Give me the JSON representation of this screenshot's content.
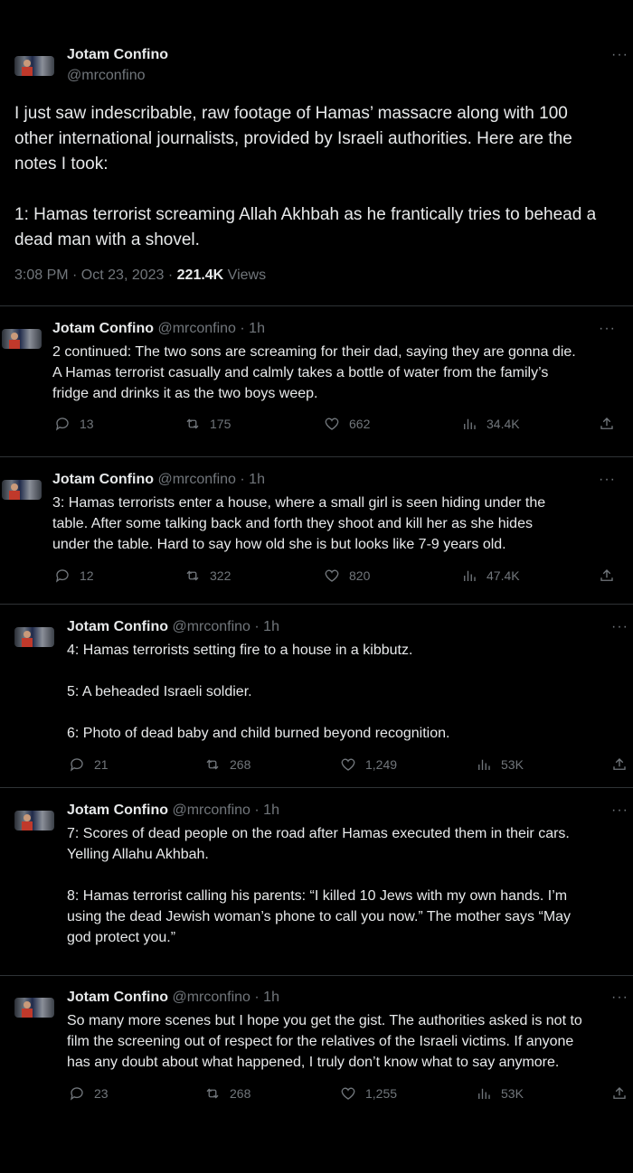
{
  "main_tweet": {
    "name": "Jotam Confino",
    "handle": "@mrconfino",
    "more": "···",
    "p1_l1": "I just saw indescribable, raw footage of Hamas’ massacre along with 100",
    "p1_l2": "other international journalists, provided by Israeli authorities. Here are the",
    "p1_l3": "notes I took:",
    "p2_l1": "1: Hamas terrorist screaming Allah Akhbah as he frantically tries to behead a",
    "p2_l2": "dead man with a shovel.",
    "timestamp": "3:08 PM · Oct 23, 2023 · ",
    "views_count": "221.4K",
    "views_label": " Views"
  },
  "replies": [
    {
      "name": "Jotam Confino",
      "handle": "@mrconfino · 1h",
      "more": "···",
      "lines": [
        "2 continued: The two sons are screaming for their dad, saying they are gonna die.",
        "A Hamas terrorist casually and calmly takes a bottle of water from the family’s",
        "fridge and drinks it as the two boys weep."
      ],
      "replies": "13",
      "retweets": "175",
      "likes": "662",
      "views": "34.4K"
    },
    {
      "name": "Jotam Confino",
      "handle": "@mrconfino · 1h",
      "more": "···",
      "lines": [
        "3: Hamas terrorists enter a house, where a small girl is seen hiding under the",
        "table. After some talking back and forth they shoot and kill her as she hides",
        "under the table. Hard to say how old she is but looks like 7-9 years old."
      ],
      "replies": "12",
      "retweets": "322",
      "likes": "820",
      "views": "47.4K"
    },
    {
      "name": "Jotam Confino",
      "handle": "@mrconfino · 1h",
      "more": "···",
      "lines": [
        "4: Hamas terrorists setting fire to a house in a kibbutz.",
        "5: A beheaded Israeli soldier.",
        "6: Photo of dead baby and child burned beyond recognition."
      ],
      "replies": "21",
      "retweets": "268",
      "likes": "1,249",
      "views": "53K"
    },
    {
      "name": "Jotam Confino",
      "handle": "@mrconfino · 1h",
      "more": "···",
      "lines": [
        "7: Scores of dead people on the road after Hamas executed them in their cars.",
        "Yelling Allahu Akhbah.",
        "8: Hamas terrorist calling his parents: “I killed 10 Jews with my own hands. I’m",
        "using the dead Jewish woman’s phone to call you now.” The mother says “May",
        "god protect you.”"
      ]
    },
    {
      "name": "Jotam Confino",
      "handle": "@mrconfino · 1h",
      "more": "···",
      "lines": [
        "So many more scenes but I hope you get the gist. The authorities asked is not to",
        "film the screening out of respect for the relatives of the Israeli victims. If anyone",
        "has any doubt about what happened, I truly don’t know what to say anymore."
      ],
      "replies": "23",
      "retweets": "268",
      "likes": "1,255",
      "views": "53K"
    }
  ]
}
